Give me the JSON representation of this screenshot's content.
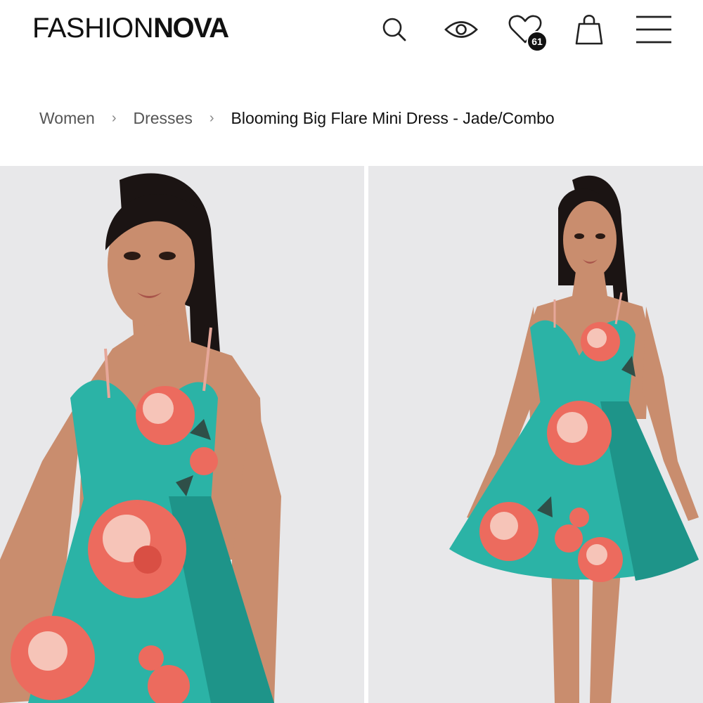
{
  "header": {
    "logo_light": "FASHION",
    "logo_bold": "NOVA",
    "wishlist_count": "61",
    "icons": [
      "search-icon",
      "eye-icon",
      "heart-icon",
      "bag-icon",
      "menu-icon"
    ]
  },
  "breadcrumb": {
    "items": [
      "Women",
      "Dresses"
    ],
    "current": "Blooming Big Flare Mini Dress - Jade/Combo",
    "separator": "›"
  },
  "gallery": {
    "colors": {
      "background": "#e8e8ea",
      "dress": "#2bb3a6",
      "dress_shadow": "#1e9489",
      "flower": "#ec6b5e",
      "flower_light": "#f6c4b8",
      "skin": "#c98d6e",
      "hair": "#1b1413"
    }
  }
}
